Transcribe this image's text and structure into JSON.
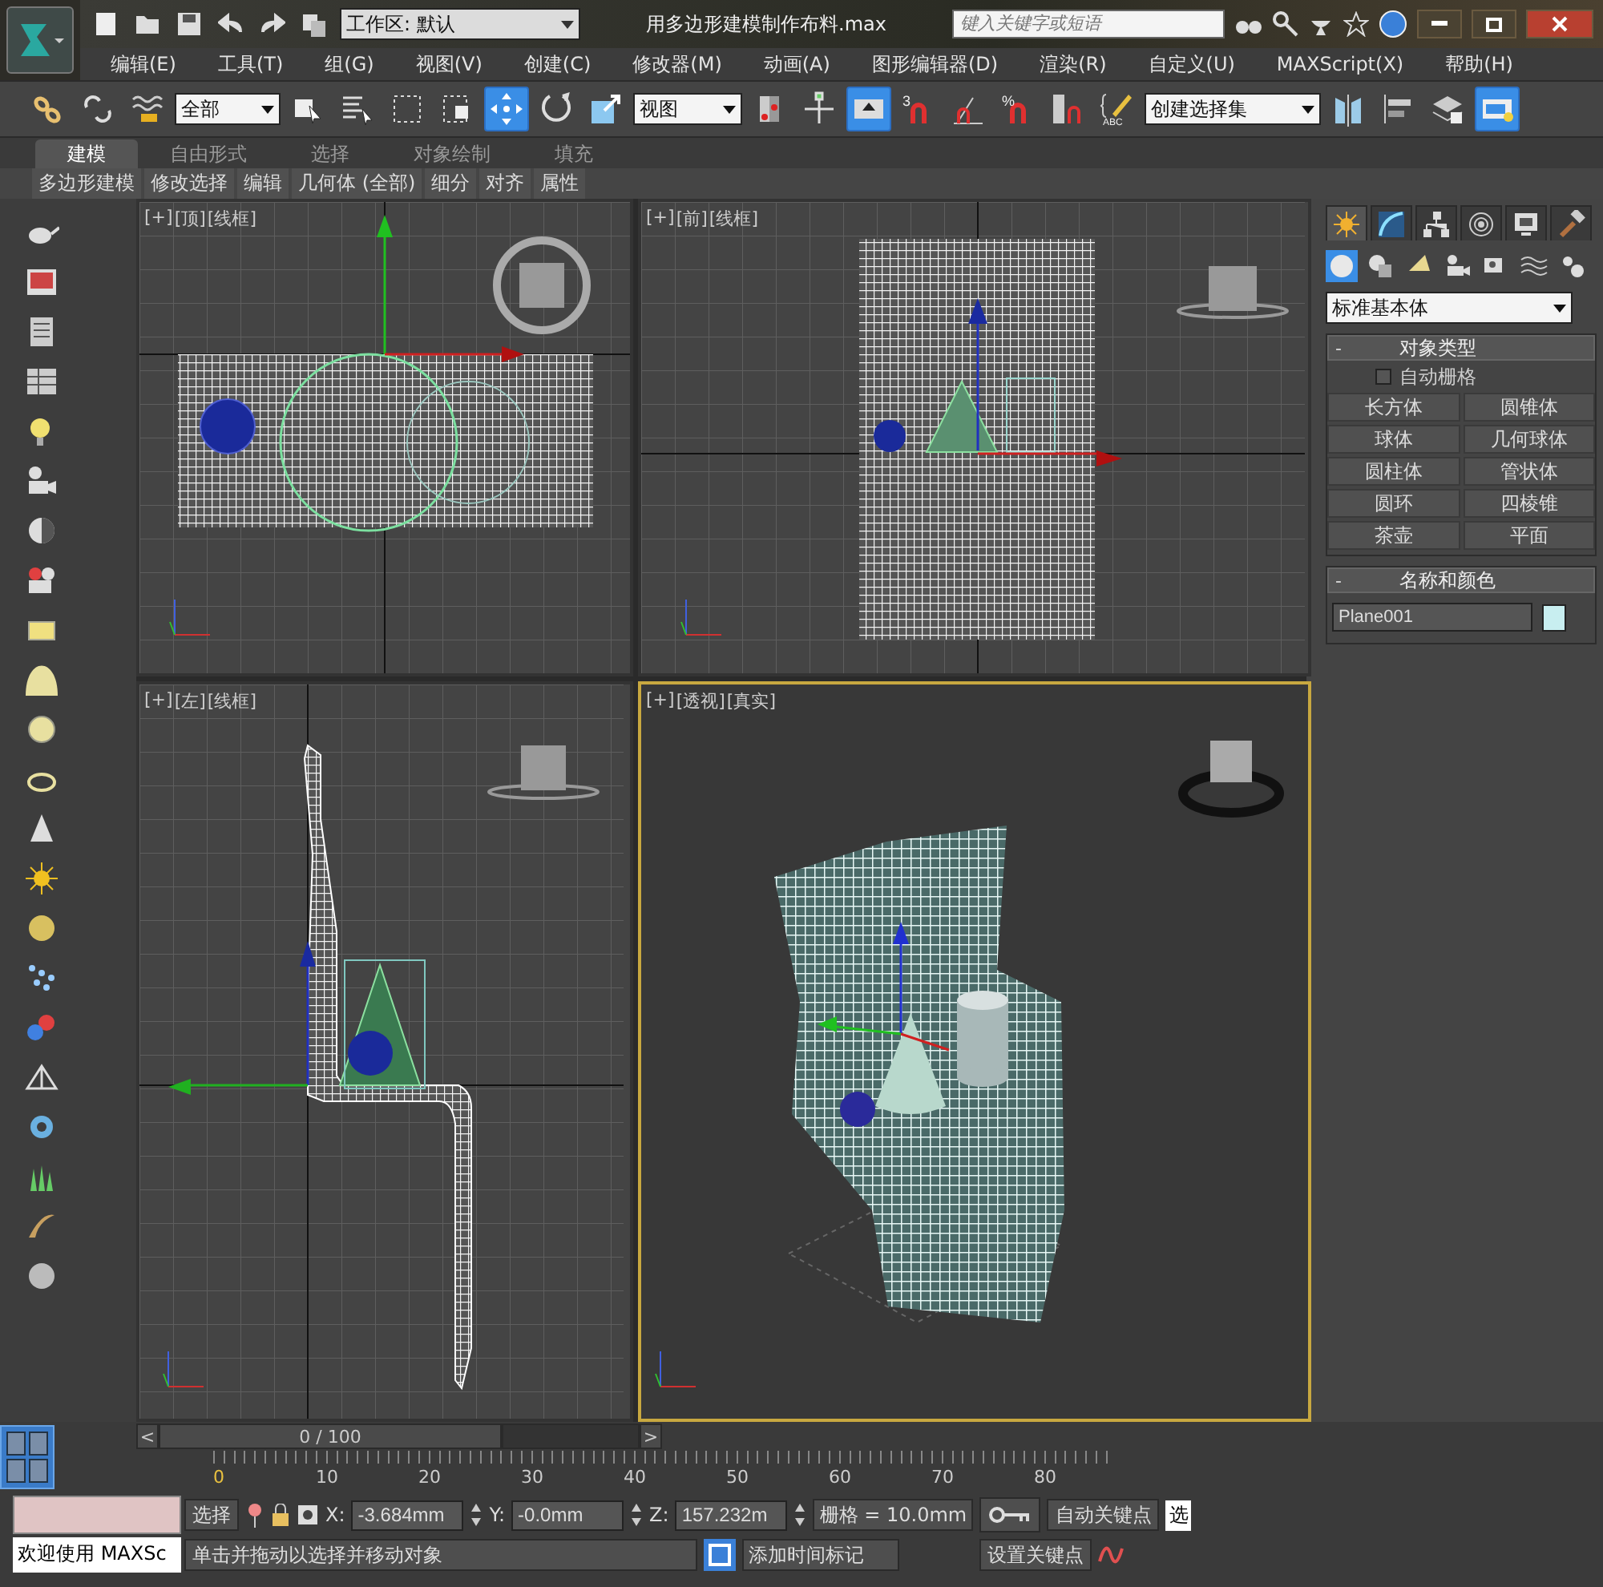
{
  "title_bar": {
    "workspace": "工作区: 默认",
    "title": "用多边形建模制作布料.max",
    "search": {
      "placeholder": "键入关键字或短语"
    }
  },
  "menu": [
    "编辑(E)",
    "工具(T)",
    "组(G)",
    "视图(V)",
    "创建(C)",
    "修改器(M)",
    "动画(A)",
    "图形编辑器(D)",
    "渲染(R)",
    "自定义(U)",
    "MAXScript(X)",
    "帮助(H)"
  ],
  "toolbar": [
    {
      "kind": "chain",
      "selected": false
    },
    {
      "kind": "broken-chain",
      "selected": false
    },
    {
      "kind": "wave",
      "selected": false
    },
    {
      "kind": "dropdown",
      "value": "全部"
    },
    {
      "kind": "cube-cursor",
      "selected": false
    },
    {
      "kind": "list-cursor",
      "selected": false
    },
    {
      "kind": "dashed-square",
      "selected": false
    },
    {
      "kind": "dashed-square-cube",
      "selected": false
    },
    {
      "kind": "four-arrows",
      "selected": true
    },
    {
      "kind": "circle-arrow",
      "selected": false
    },
    {
      "kind": "scale-box",
      "selected": false
    },
    {
      "kind": "dropdown",
      "value": "视图"
    },
    {
      "kind": "pivot",
      "selected": false
    },
    {
      "kind": "cross-arrows",
      "selected": false
    },
    {
      "kind": "keyboard-up",
      "selected": true
    },
    {
      "kind": "magnet",
      "selected": false,
      "label": "3"
    },
    {
      "kind": "angle-magnet",
      "selected": false
    },
    {
      "kind": "magnet",
      "selected": false,
      "label": "%"
    },
    {
      "kind": "spinner-magnet",
      "selected": false
    },
    {
      "kind": "braces-pencil",
      "selected": false,
      "label": "ABC"
    },
    {
      "kind": "dropdown",
      "value": "创建选择集"
    },
    {
      "kind": "mirror",
      "selected": false
    },
    {
      "kind": "align",
      "selected": false
    },
    {
      "kind": "layers",
      "selected": false
    },
    {
      "kind": "render",
      "selected": true
    }
  ],
  "ribbon": {
    "tabs": [
      {
        "label": "建模",
        "selected": true
      },
      {
        "label": "自由形式",
        "selected": false
      },
      {
        "label": "选择",
        "selected": false
      },
      {
        "label": "对象绘制",
        "selected": false
      },
      {
        "label": "填充",
        "selected": false
      }
    ],
    "panels": [
      "多边形建模",
      "修改选择",
      "编辑",
      "几何体 (全部)",
      "细分",
      "对齐",
      "属性"
    ]
  },
  "viewports": [
    {
      "kind": "top",
      "labels": [
        "[+]",
        "[顶]",
        "[线框]"
      ],
      "active": false
    },
    {
      "kind": "front",
      "labels": [
        "[+]",
        "[前]",
        "[线框]"
      ],
      "active": false
    },
    {
      "kind": "left",
      "labels": [
        "[+]",
        "[左]",
        "[线框]"
      ],
      "active": false
    },
    {
      "kind": "perspective",
      "labels": [
        "[+]",
        "[透视]",
        "[真实]"
      ],
      "active": true
    }
  ],
  "command_panel": {
    "tabs": [
      {
        "kind": "create",
        "selected": true
      },
      {
        "kind": "modify",
        "selected": false
      },
      {
        "kind": "hierarchy",
        "selected": false
      },
      {
        "kind": "motion",
        "selected": false
      },
      {
        "kind": "display",
        "selected": false
      },
      {
        "kind": "utilities",
        "selected": false
      }
    ],
    "categories": [
      {
        "kind": "geometry",
        "selected": true
      },
      {
        "kind": "shapes",
        "selected": false
      },
      {
        "kind": "lights",
        "selected": false
      },
      {
        "kind": "cameras",
        "selected": false
      },
      {
        "kind": "helpers",
        "selected": false
      },
      {
        "kind": "spacewarps",
        "selected": false
      },
      {
        "kind": "systems",
        "selected": false
      }
    ],
    "dropdown": "标准基本体",
    "object_type": {
      "toggle": "-",
      "title": "对象类型",
      "autogrid": {
        "label": "自动栅格",
        "checked": false
      },
      "buttons": [
        "长方体",
        "圆锥体",
        "球体",
        "几何球体",
        "圆柱体",
        "管状体",
        "圆环",
        "四棱锥",
        "茶壶",
        "平面"
      ]
    },
    "name_color": {
      "toggle": "-",
      "title": "名称和颜色",
      "name": "Plane001",
      "color": "#c8eef0"
    }
  },
  "timeline": {
    "prev": "<",
    "slider": "0 / 100",
    "next": ">",
    "ticks": [
      "0",
      "10",
      "20",
      "30",
      "40",
      "50",
      "60",
      "70",
      "80"
    ]
  },
  "status": {
    "listener": "欢迎使用 MAXSc",
    "selection": "选择",
    "coords": [
      {
        "axis": "X:",
        "value": "-3.684mm"
      },
      {
        "axis": "Y:",
        "value": "-0.0mm"
      },
      {
        "axis": "Z:",
        "value": "157.232m"
      }
    ],
    "grid": "栅格 = 10.0mm",
    "prompt": "单击并拖动以选择并移动对象",
    "add_time_tag": "添加时间标记",
    "auto_key": "自动关键点",
    "set_key": "设置关键点",
    "selection_cut": "选"
  }
}
